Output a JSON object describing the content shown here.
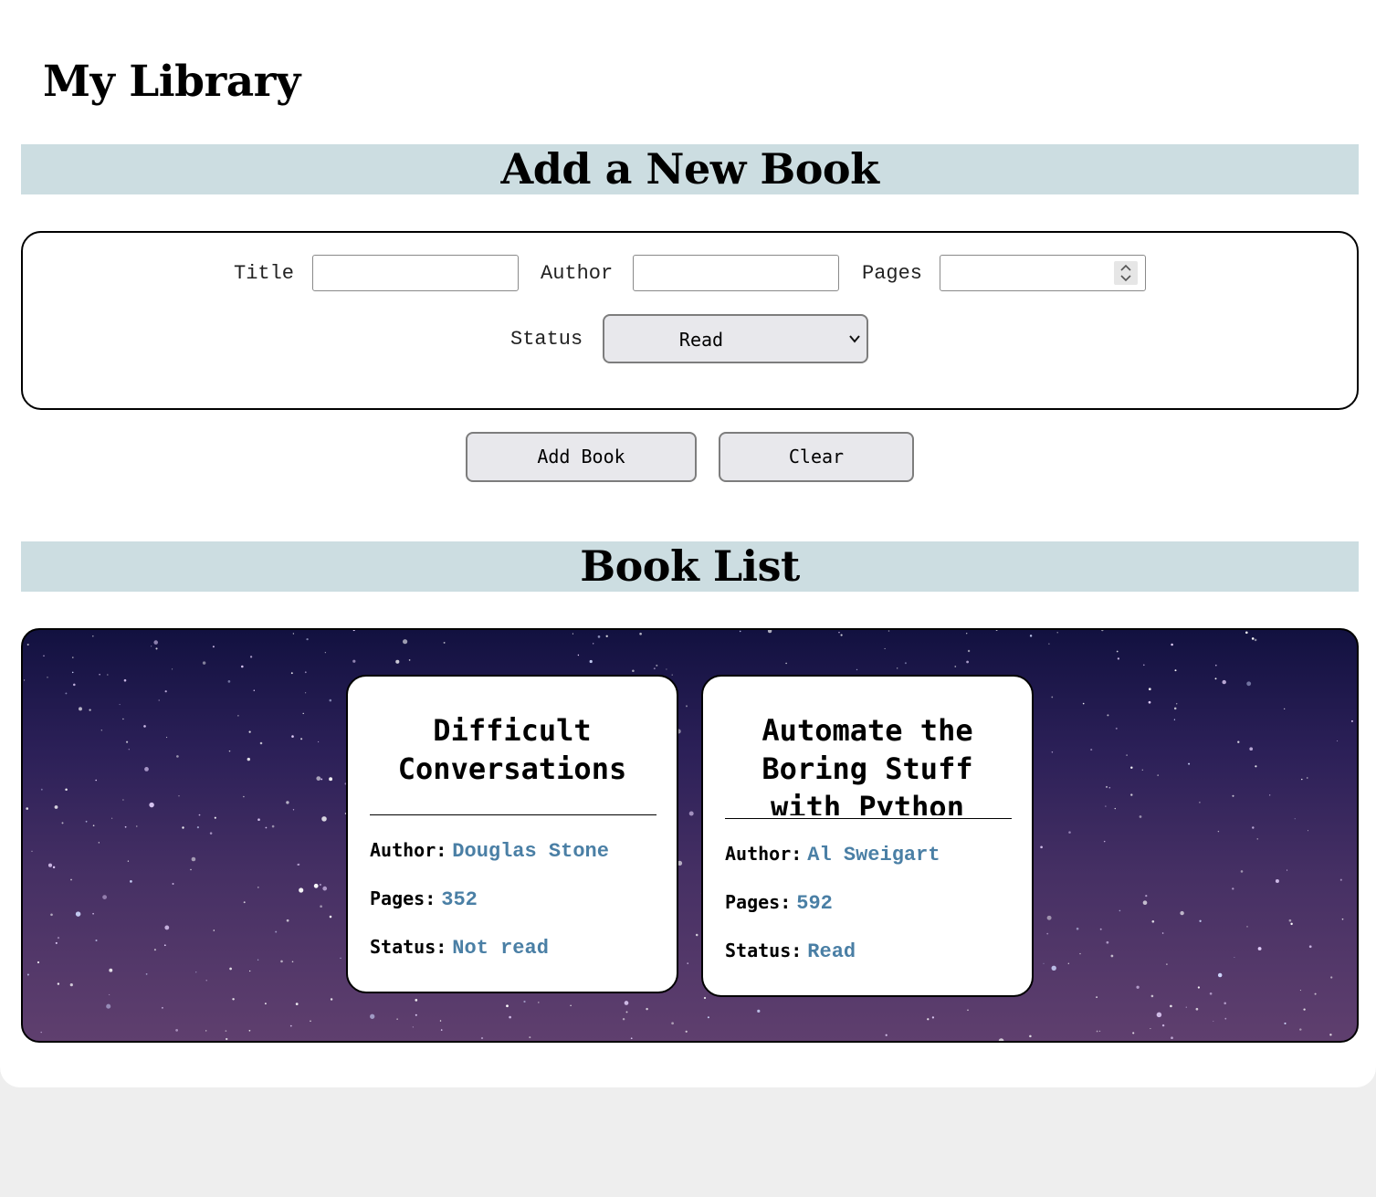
{
  "app": {
    "title": "My Library"
  },
  "add_section": {
    "heading": "Add a New Book",
    "fields": {
      "title_label": "Title",
      "title_value": "",
      "author_label": "Author",
      "author_value": "",
      "pages_label": "Pages",
      "pages_value": "",
      "status_label": "Status",
      "status_selected": "Read"
    },
    "buttons": {
      "add_label": "Add Book",
      "clear_label": "Clear"
    }
  },
  "list_section": {
    "heading": "Book List",
    "books": [
      {
        "title": "Difficult Conversations",
        "author_label": "Author:",
        "author": "Douglas Stone",
        "pages_label": "Pages:",
        "pages": "352",
        "status_label": "Status:",
        "status": "Not read"
      },
      {
        "title": "Automate the Boring Stuff with Python",
        "author_label": "Author:",
        "author": "Al Sweigart",
        "pages_label": "Pages:",
        "pages": "592",
        "status_label": "Status:",
        "status": "Read"
      }
    ]
  },
  "colors": {
    "header_band": "#ccdde1",
    "value_text": "#4a7fa5",
    "button_bg": "#e8e8ec"
  },
  "icons": {
    "select": "chevron-down-icon",
    "number_input": "spinner-icon"
  }
}
